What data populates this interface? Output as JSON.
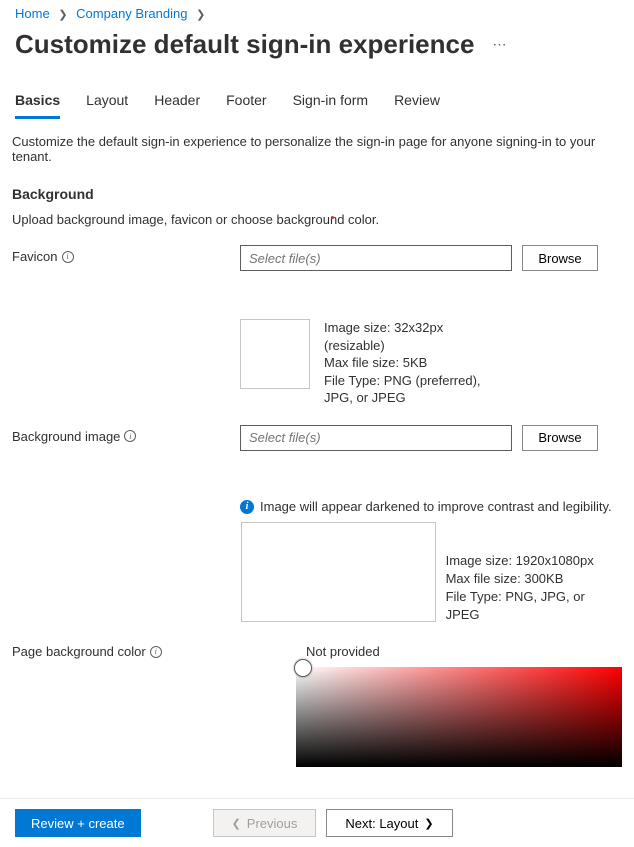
{
  "breadcrumb": {
    "items": [
      {
        "label": "Home"
      },
      {
        "label": "Company Branding"
      }
    ]
  },
  "page": {
    "title": "Customize default sign-in experience"
  },
  "tabs": [
    {
      "label": "Basics",
      "active": true
    },
    {
      "label": "Layout"
    },
    {
      "label": "Header"
    },
    {
      "label": "Footer"
    },
    {
      "label": "Sign-in form"
    },
    {
      "label": "Review"
    }
  ],
  "intro": "Customize the default sign-in experience to personalize the sign-in page for anyone signing-in to your tenant.",
  "background": {
    "heading": "Background",
    "sub": "Upload background image, favicon or choose background color."
  },
  "favicon": {
    "label": "Favicon",
    "placeholder": "Select file(s)",
    "browse": "Browse",
    "hint": {
      "l1": "Image size: 32x32px",
      "l2": "(resizable)",
      "l3": "Max file size: 5KB",
      "l4": "File Type: PNG (preferred),",
      "l5": "JPG, or JPEG"
    }
  },
  "bgimage": {
    "label": "Background image",
    "placeholder": "Select file(s)",
    "browse": "Browse",
    "callout": "Image will appear darkened to improve contrast and legibility.",
    "hint": {
      "l1": "Image size: 1920x1080px",
      "l2": "Max file size: 300KB",
      "l3": "File Type: PNG, JPG, or JPEG"
    }
  },
  "bgcolor": {
    "label": "Page background color",
    "value": "Not provided"
  },
  "footer": {
    "review": "Review + create",
    "previous": "Previous",
    "next": "Next: Layout"
  }
}
